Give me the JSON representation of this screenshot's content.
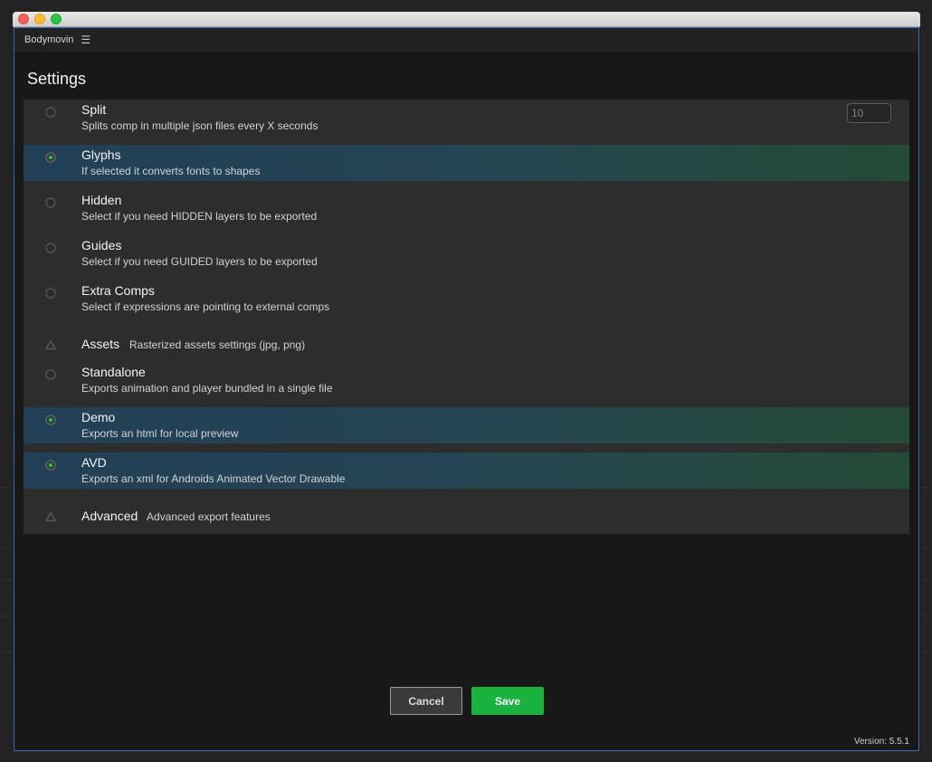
{
  "window": {
    "app_title": "Bodymovin"
  },
  "settings": {
    "title": "Settings",
    "options": [
      {
        "id": "split",
        "title": "Split",
        "description": "Splits comp in multiple json files every X seconds",
        "selected": false,
        "input_value": "10"
      },
      {
        "id": "glyphs",
        "title": "Glyphs",
        "description": "If selected it converts fonts to shapes",
        "selected": true
      },
      {
        "id": "hidden",
        "title": "Hidden",
        "description": "Select if you need HIDDEN layers to be exported",
        "selected": false
      },
      {
        "id": "guides",
        "title": "Guides",
        "description": "Select if you need GUIDED layers to be exported",
        "selected": false
      },
      {
        "id": "extra_comps",
        "title": "Extra Comps",
        "description": "Select if expressions are pointing to external comps",
        "selected": false
      },
      {
        "id": "standalone",
        "title": "Standalone",
        "description": "Exports animation and player bundled in a single file",
        "selected": false
      },
      {
        "id": "demo",
        "title": "Demo",
        "description": "Exports an html for local preview",
        "selected": true
      },
      {
        "id": "avd",
        "title": "AVD",
        "description": "Exports an xml for Androids Animated Vector Drawable",
        "selected": true
      }
    ],
    "sections": {
      "assets": {
        "title": "Assets",
        "description": "Rasterized assets settings (jpg, png)"
      },
      "advanced": {
        "title": "Advanced",
        "description": "Advanced export features"
      }
    }
  },
  "buttons": {
    "cancel": "Cancel",
    "save": "Save"
  },
  "version": "Version: 5.5.1",
  "icons": {
    "menu": "hamburger-menu-icon",
    "section": "triangle-expand-icon"
  },
  "colors": {
    "accent_green": "#17b33d",
    "selected_row_start": "#213f57",
    "selected_row_end": "#234b35",
    "panel_border": "#3b6cc2"
  }
}
